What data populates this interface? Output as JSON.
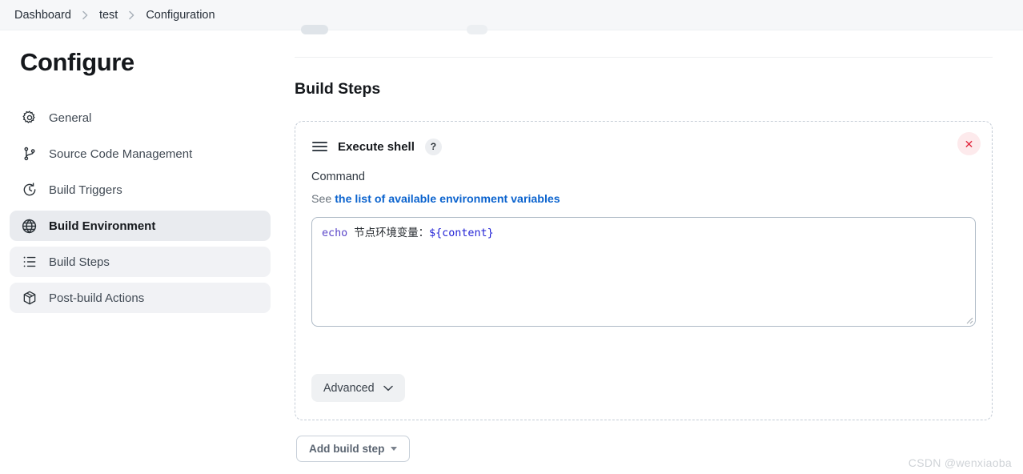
{
  "breadcrumb": {
    "items": [
      {
        "label": "Dashboard"
      },
      {
        "label": "test"
      },
      {
        "label": "Configuration"
      }
    ]
  },
  "sidebar": {
    "title": "Configure",
    "items": [
      {
        "label": "General",
        "icon": "gear-icon",
        "state": "normal"
      },
      {
        "label": "Source Code Management",
        "icon": "branch-icon",
        "state": "normal"
      },
      {
        "label": "Build Triggers",
        "icon": "clock-icon",
        "state": "normal"
      },
      {
        "label": "Build Environment",
        "icon": "globe-icon",
        "state": "active"
      },
      {
        "label": "Build Steps",
        "icon": "list-icon",
        "state": "semi"
      },
      {
        "label": "Post-build Actions",
        "icon": "package-icon",
        "state": "semi"
      }
    ]
  },
  "main": {
    "section_title": "Build Steps",
    "step": {
      "name": "Execute shell",
      "help_label": "?",
      "delete_label": "✕",
      "command_label": "Command",
      "env_prefix": "See",
      "env_link": "the list of available environment variables",
      "command": {
        "keyword": "echo",
        "text": " 节点环境变量：",
        "variable": "${content}"
      },
      "advanced_label": "Advanced"
    },
    "add_build_step_label": "Add build step"
  },
  "watermark": "CSDN @wenxiaoba",
  "colors": {
    "link": "#0b63ce",
    "keyword": "#5b46c9",
    "variable": "#2323d6",
    "delete": "#e2273d",
    "active_nav_bg": "#e9ebef"
  }
}
